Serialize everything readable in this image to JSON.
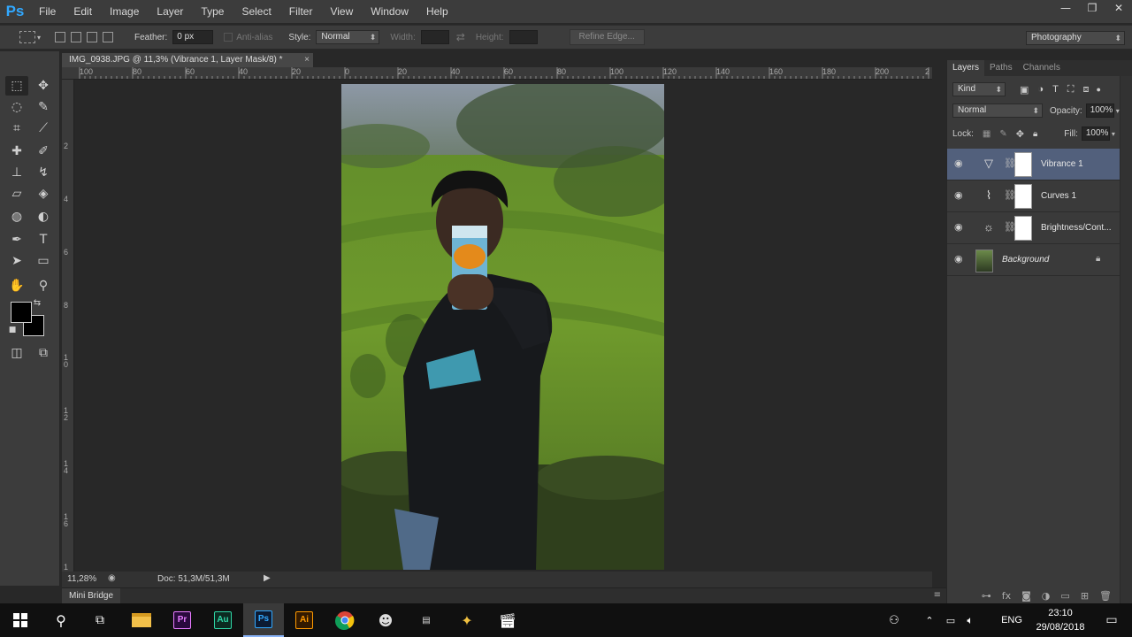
{
  "app": {
    "logo": "Ps",
    "window_controls": [
      "—",
      "❐",
      "✕"
    ]
  },
  "menu": [
    "File",
    "Edit",
    "Image",
    "Layer",
    "Type",
    "Select",
    "Filter",
    "View",
    "Window",
    "Help"
  ],
  "options": {
    "feather_label": "Feather:",
    "feather_value": "0 px",
    "antialias_label": "Anti-alias",
    "style_label": "Style:",
    "style_value": "Normal",
    "width_label": "Width:",
    "height_label": "Height:",
    "refine_edge": "Refine Edge...",
    "workspace": "Photography"
  },
  "document": {
    "tab_title": "IMG_0938.JPG @ 11,3% (Vibrance 1, Layer Mask/8) *",
    "close": "×",
    "hruler_labels": [
      "100",
      "80",
      "60",
      "40",
      "20",
      "0",
      "20",
      "40",
      "60",
      "80",
      "100",
      "120",
      "140",
      "160",
      "180",
      "200",
      "2"
    ],
    "vruler_labels": [
      "2",
      "4",
      "6",
      "8",
      "1 0",
      "1 2",
      "1 4",
      "1 6",
      "1"
    ],
    "zoom": "11,28%",
    "doc_size": "Doc: 51,3M/51,3M"
  },
  "minibridge": {
    "label": "Mini Bridge"
  },
  "layers_panel": {
    "tabs": [
      "Layers",
      "Paths",
      "Channels"
    ],
    "filter": "Kind",
    "blend_mode": "Normal",
    "opacity_label": "Opacity:",
    "opacity_value": "100%",
    "lock_label": "Lock:",
    "fill_label": "Fill:",
    "fill_value": "100%",
    "layers": [
      {
        "name": "Vibrance 1",
        "icon": "vibrance-icon"
      },
      {
        "name": "Curves 1",
        "icon": "curves-icon"
      },
      {
        "name": "Brightness/Cont...",
        "icon": "brightness-icon"
      },
      {
        "name": "Background",
        "icon": "image-thumbnail"
      }
    ]
  },
  "taskbar": {
    "language": "ENG",
    "time": "23:10",
    "date": "29/08/2018",
    "apps": [
      {
        "label": "Pr",
        "color": "#2a0a3d",
        "fg": "#e77bff"
      },
      {
        "label": "Au",
        "color": "#0b2b21",
        "fg": "#2fd6a6"
      },
      {
        "label": "Ps",
        "color": "#0c1b33",
        "fg": "#31a8ff"
      },
      {
        "label": "Ai",
        "color": "#331a00",
        "fg": "#ff9a00"
      }
    ]
  },
  "colors": {
    "accent_selected": "#52607c",
    "ps_blue": "#31a8ff"
  }
}
